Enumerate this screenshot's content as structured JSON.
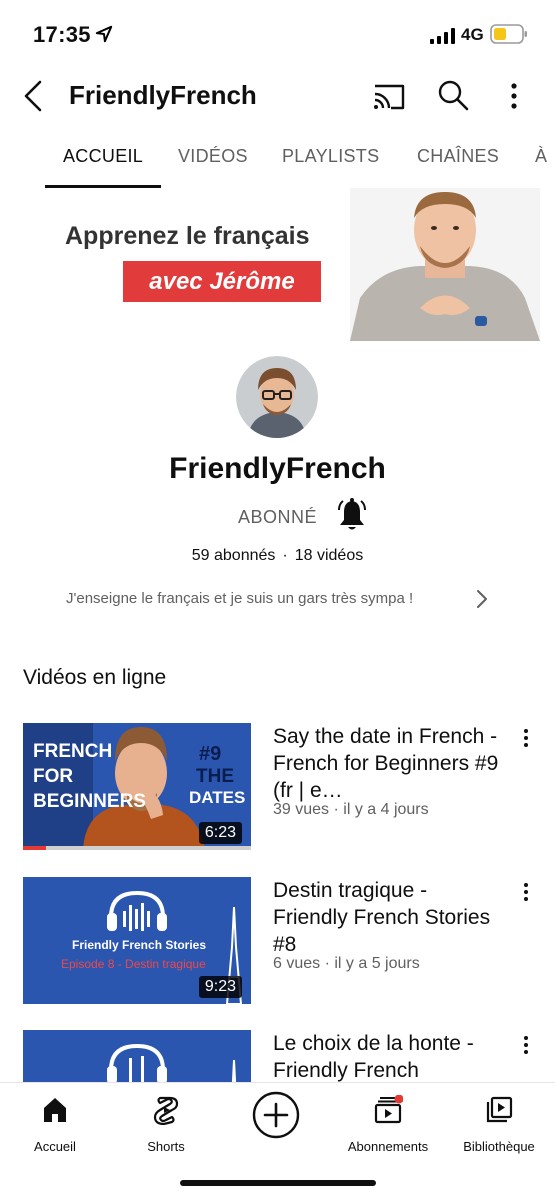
{
  "status_bar": {
    "time": "17:35",
    "network": "4G"
  },
  "header": {
    "title": "FriendlyFrench"
  },
  "tabs": [
    {
      "label": "ACCUEIL"
    },
    {
      "label": "VIDÉOS"
    },
    {
      "label": "PLAYLISTS"
    },
    {
      "label": "CHAÎNES"
    },
    {
      "label": "À"
    }
  ],
  "banner": {
    "headline": "Apprenez le français",
    "tagline": "avec Jérôme"
  },
  "channel": {
    "name": "FriendlyFrench",
    "subscribe_label": "ABONNÉ",
    "subscribers": "59 abonnés",
    "separator": "·",
    "video_count": "18 vidéos",
    "description": "J'enseigne le français et je suis un gars très sympa !"
  },
  "section": {
    "title": "Vidéos en ligne"
  },
  "videos": [
    {
      "title": "Say the date in French - French for Beginners #9 (fr | e…",
      "meta": "39 vues · il y a 4 jours",
      "duration": "6:23",
      "watched_fraction": 0.1,
      "thumb_text": {
        "line1": "FRENCH",
        "line2": "FOR",
        "line3": "BEGINNERS",
        "number": "#9",
        "word1": "THE",
        "word2": "DATES"
      }
    },
    {
      "title": "Destin tragique - Friendly French Stories #8",
      "meta": "6 vues · il y a 5 jours",
      "duration": "9:23",
      "thumb_text": {
        "series": "Friendly French Stories",
        "episode": "Episode 8 - Destin tragique"
      }
    },
    {
      "title": "Le choix de la honte - Friendly French",
      "meta": "",
      "duration": ""
    }
  ],
  "bottom_nav": [
    {
      "label": "Accueil",
      "icon": "home-icon"
    },
    {
      "label": "Shorts",
      "icon": "shorts-icon"
    },
    {
      "label": "",
      "icon": "create-icon"
    },
    {
      "label": "Abonnements",
      "icon": "subscriptions-icon"
    },
    {
      "label": "Bibliothèque",
      "icon": "library-icon"
    }
  ],
  "colors": {
    "accent_red": "#e23b3b",
    "thumb_blue": "#2a56b0",
    "text_secondary": "#606060"
  }
}
